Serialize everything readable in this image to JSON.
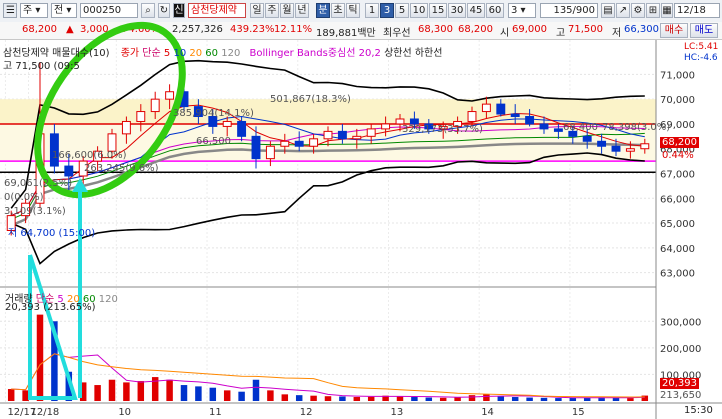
{
  "toolbar": {
    "market": "주",
    "type": "전",
    "code": "000250",
    "stock_name": "삼천당제약",
    "periods": [
      "일",
      "주",
      "월",
      "년",
      "분",
      "초",
      "틱"
    ],
    "active_period": "분",
    "intervals": [
      "1",
      "3",
      "5",
      "10",
      "15",
      "30",
      "45",
      "60"
    ],
    "active_interval": "3",
    "interval_select": "3",
    "count": "135/900",
    "date": "12/18"
  },
  "quote": {
    "price": "68,200",
    "change": "3,000",
    "change_pct": "+4.60%",
    "volume": "2,257,326",
    "vol_ratio": "439.23%",
    "turnover": "12.11%",
    "amount": "189,881백만",
    "best_ask_label": "최우선",
    "best_ask": "68,300",
    "best_bid": "68,200",
    "open_label": "시",
    "open": "69,000",
    "high_label": "고",
    "high": "71,500",
    "low_label": "저",
    "low": "66,300"
  },
  "side_buttons": {
    "buy": "매수",
    "sell": "매도"
  },
  "price_legend": {
    "title": "삼천당제약 매물대수(10)",
    "close": "종가",
    "ma_label": "단순",
    "ma_periods": [
      "5",
      "10",
      "20",
      "60",
      "120"
    ],
    "bollinger": "Bollinger Bands중심선 20,2",
    "upper": "상한선",
    "lower": "하한선"
  },
  "corner_labels": {
    "lc": "LC:5.41",
    "hc": "HC:-4.6"
  },
  "price_annotations": {
    "high_mark": "고 71,500 (09:5",
    "vp1": "501,867(18.3%)",
    "vp2": "385,904(14.1%)",
    "vp3": "329,173(33.7%)",
    "vp4": "166,600(6.0%)",
    "vp5": "263,245(9.6%)",
    "vp6": "69,061(2.5%)",
    "vp7": "0(0.0%)",
    "vp8": "3,109(3.1%)",
    "low_mark": "저 64,700 (15:00)",
    "vp9": "66,500",
    "vp10": "68,400",
    "vp11": "78,398(3.0%)"
  },
  "price_axis": {
    "ticks": [
      "71,000",
      "70,000",
      "69,000",
      "68,000",
      "67,000",
      "66,000",
      "65,000",
      "64,000",
      "63,000"
    ],
    "current": "68,200",
    "current_pct": "0.44%"
  },
  "volume_legend": {
    "title": "거래량",
    "ma_label": "단순",
    "ma_periods": [
      "5",
      "20",
      "60",
      "120"
    ],
    "value": "20,393",
    "pct": "(213.65%)"
  },
  "volume_axis": {
    "ticks": [
      "300,000",
      "200,000",
      "100,000"
    ],
    "current": "20,393",
    "current2": "213,650"
  },
  "x_axis": {
    "labels": [
      "12/17",
      "12/18",
      "10",
      "11",
      "12",
      "13",
      "14",
      "15"
    ],
    "time": "15:30"
  },
  "chart_data": {
    "type": "candlestick",
    "interval": "3분",
    "sessions": [
      "12/17",
      "12/18"
    ],
    "price_ylim": [
      62500,
      71500
    ],
    "volume_ylim": [
      0,
      380000
    ],
    "reference_lines": {
      "red": 69000,
      "magenta": 67500,
      "black": 67050
    },
    "x_labels": [
      "12/17",
      "12/18",
      "10",
      "11",
      "12",
      "13",
      "14",
      "15"
    ],
    "candles": [
      {
        "o": 64700,
        "h": 65500,
        "l": 64500,
        "c": 65300,
        "v": 45000
      },
      {
        "o": 65300,
        "h": 66000,
        "l": 65000,
        "c": 65800,
        "v": 40000
      },
      {
        "o": 65800,
        "h": 71500,
        "l": 65600,
        "c": 68600,
        "v": 325000
      },
      {
        "o": 68600,
        "h": 69000,
        "l": 67000,
        "c": 67300,
        "v": 300000
      },
      {
        "o": 67300,
        "h": 67800,
        "l": 66300,
        "c": 66900,
        "v": 110000
      },
      {
        "o": 66900,
        "h": 67700,
        "l": 66400,
        "c": 67500,
        "v": 70000
      },
      {
        "o": 67500,
        "h": 68100,
        "l": 67100,
        "c": 67900,
        "v": 60000
      },
      {
        "o": 67900,
        "h": 68800,
        "l": 67600,
        "c": 68600,
        "v": 80000
      },
      {
        "o": 68600,
        "h": 69300,
        "l": 68200,
        "c": 69100,
        "v": 70000
      },
      {
        "o": 69100,
        "h": 69800,
        "l": 68700,
        "c": 69500,
        "v": 75000
      },
      {
        "o": 69500,
        "h": 70300,
        "l": 69200,
        "c": 70000,
        "v": 90000
      },
      {
        "o": 70000,
        "h": 70600,
        "l": 69600,
        "c": 70300,
        "v": 80000
      },
      {
        "o": 70300,
        "h": 70500,
        "l": 69500,
        "c": 69700,
        "v": 60000
      },
      {
        "o": 69700,
        "h": 70000,
        "l": 69000,
        "c": 69300,
        "v": 55000
      },
      {
        "o": 69300,
        "h": 69600,
        "l": 68600,
        "c": 68900,
        "v": 50000
      },
      {
        "o": 68900,
        "h": 69300,
        "l": 68500,
        "c": 69100,
        "v": 40000
      },
      {
        "o": 69100,
        "h": 69300,
        "l": 68300,
        "c": 68500,
        "v": 35000
      },
      {
        "o": 68500,
        "h": 68900,
        "l": 67200,
        "c": 67600,
        "v": 80000
      },
      {
        "o": 67600,
        "h": 68300,
        "l": 67300,
        "c": 68100,
        "v": 40000
      },
      {
        "o": 68100,
        "h": 68600,
        "l": 67800,
        "c": 68300,
        "v": 25000
      },
      {
        "o": 68300,
        "h": 68700,
        "l": 67900,
        "c": 68100,
        "v": 22000
      },
      {
        "o": 68100,
        "h": 68600,
        "l": 67800,
        "c": 68400,
        "v": 20000
      },
      {
        "o": 68400,
        "h": 68900,
        "l": 68100,
        "c": 68700,
        "v": 18000
      },
      {
        "o": 68700,
        "h": 69000,
        "l": 68200,
        "c": 68400,
        "v": 17000
      },
      {
        "o": 68400,
        "h": 68800,
        "l": 68000,
        "c": 68500,
        "v": 15000
      },
      {
        "o": 68500,
        "h": 69000,
        "l": 68200,
        "c": 68800,
        "v": 16000
      },
      {
        "o": 68800,
        "h": 69300,
        "l": 68500,
        "c": 69000,
        "v": 20000
      },
      {
        "o": 69000,
        "h": 69400,
        "l": 68700,
        "c": 69200,
        "v": 18000
      },
      {
        "o": 69200,
        "h": 69500,
        "l": 68800,
        "c": 69000,
        "v": 15000
      },
      {
        "o": 69000,
        "h": 69200,
        "l": 68600,
        "c": 68800,
        "v": 13000
      },
      {
        "o": 68800,
        "h": 69100,
        "l": 68400,
        "c": 68900,
        "v": 12000
      },
      {
        "o": 68900,
        "h": 69300,
        "l": 68600,
        "c": 69100,
        "v": 14000
      },
      {
        "o": 69100,
        "h": 69700,
        "l": 68900,
        "c": 69500,
        "v": 22000
      },
      {
        "o": 69500,
        "h": 70100,
        "l": 69200,
        "c": 69800,
        "v": 26000
      },
      {
        "o": 69800,
        "h": 70000,
        "l": 69300,
        "c": 69400,
        "v": 18000
      },
      {
        "o": 69400,
        "h": 69800,
        "l": 69000,
        "c": 69300,
        "v": 15000
      },
      {
        "o": 69300,
        "h": 69600,
        "l": 68900,
        "c": 69000,
        "v": 13000
      },
      {
        "o": 69000,
        "h": 69300,
        "l": 68600,
        "c": 68800,
        "v": 12000
      },
      {
        "o": 68800,
        "h": 69000,
        "l": 68400,
        "c": 68700,
        "v": 11000
      },
      {
        "o": 68700,
        "h": 68900,
        "l": 68200,
        "c": 68500,
        "v": 12000
      },
      {
        "o": 68500,
        "h": 68800,
        "l": 68000,
        "c": 68300,
        "v": 13000
      },
      {
        "o": 68300,
        "h": 68600,
        "l": 67800,
        "c": 68100,
        "v": 14000
      },
      {
        "o": 68100,
        "h": 68400,
        "l": 67700,
        "c": 67900,
        "v": 12000
      },
      {
        "o": 67900,
        "h": 68300,
        "l": 67600,
        "c": 68000,
        "v": 11000
      },
      {
        "o": 68000,
        "h": 68400,
        "l": 67800,
        "c": 68200,
        "v": 20393
      }
    ]
  }
}
